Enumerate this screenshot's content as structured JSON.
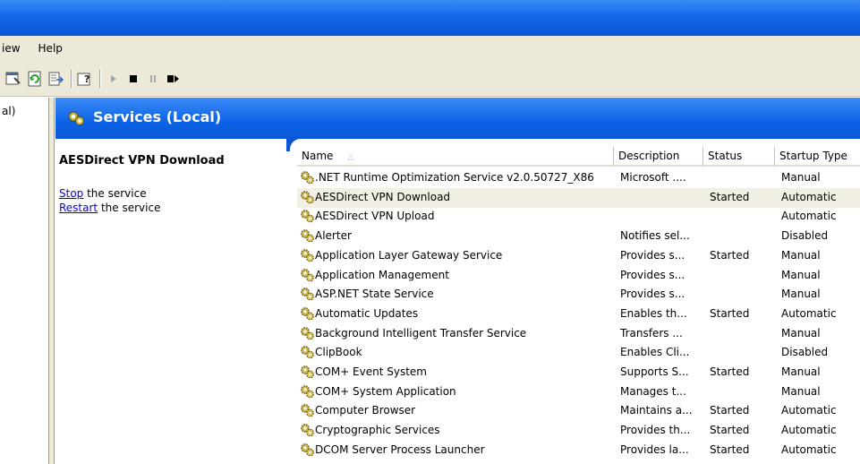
{
  "menubar": {
    "items": [
      "View",
      "Help"
    ],
    "partial_first": "iew"
  },
  "tree": {
    "node_partial": "al)"
  },
  "header": {
    "title": "Services (Local)"
  },
  "extended": {
    "service_name": "AESDirect VPN Download",
    "stop_link": "Stop",
    "stop_text": " the service",
    "restart_link": "Restart",
    "restart_text": " the service"
  },
  "columns": [
    "Name",
    "Description",
    "Status",
    "Startup Type"
  ],
  "rows": [
    {
      "name": ".NET Runtime Optimization Service v2.0.50727_X86",
      "description": "Microsoft ....",
      "status": "",
      "startup": "Manual"
    },
    {
      "name": "AESDirect VPN Download",
      "description": "",
      "status": "Started",
      "startup": "Automatic"
    },
    {
      "name": "AESDirect VPN Upload",
      "description": "",
      "status": "",
      "startup": "Automatic"
    },
    {
      "name": "Alerter",
      "description": "Notifies sel...",
      "status": "",
      "startup": "Disabled"
    },
    {
      "name": "Application Layer Gateway Service",
      "description": "Provides s...",
      "status": "Started",
      "startup": "Manual"
    },
    {
      "name": "Application Management",
      "description": "Provides s...",
      "status": "",
      "startup": "Manual"
    },
    {
      "name": "ASP.NET State Service",
      "description": "Provides s...",
      "status": "",
      "startup": "Manual"
    },
    {
      "name": "Automatic Updates",
      "description": "Enables th...",
      "status": "Started",
      "startup": "Automatic"
    },
    {
      "name": "Background Intelligent Transfer Service",
      "description": "Transfers ...",
      "status": "",
      "startup": "Manual"
    },
    {
      "name": "ClipBook",
      "description": "Enables Cli...",
      "status": "",
      "startup": "Disabled"
    },
    {
      "name": "COM+ Event System",
      "description": "Supports S...",
      "status": "Started",
      "startup": "Manual"
    },
    {
      "name": "COM+ System Application",
      "description": "Manages t...",
      "status": "",
      "startup": "Manual"
    },
    {
      "name": "Computer Browser",
      "description": "Maintains a...",
      "status": "Started",
      "startup": "Automatic"
    },
    {
      "name": "Cryptographic Services",
      "description": "Provides th...",
      "status": "Started",
      "startup": "Automatic"
    },
    {
      "name": "DCOM Server Process Launcher",
      "description": "Provides la...",
      "status": "Started",
      "startup": "Automatic"
    }
  ],
  "selected_index": 1,
  "icons": {
    "toolbar": [
      "properties-icon",
      "refresh-icon",
      "export-list-icon",
      "help-icon",
      "start-service-icon",
      "stop-service-icon",
      "pause-service-icon",
      "restart-service-icon"
    ],
    "service": "gear-service-icon"
  },
  "colors": {
    "title_blue": "#0a58d8",
    "chrome": "#ece9d8",
    "link": "#0000ff"
  }
}
